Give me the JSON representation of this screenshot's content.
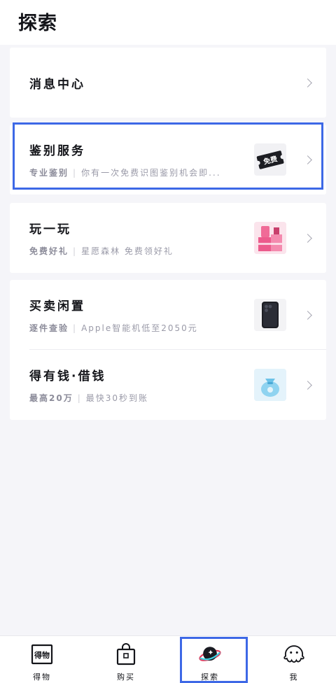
{
  "header": {
    "title": "探索"
  },
  "rows": {
    "messages": {
      "title": "消息中心"
    },
    "appraisal": {
      "title": "鉴别服务",
      "tag": "专业鉴别",
      "desc": "你有一次免费识图鉴别机会即...",
      "badge": "免费"
    },
    "play": {
      "title": "玩一玩",
      "tag": "免费好礼",
      "desc": "星愿森林 免费领好礼"
    },
    "trade": {
      "title": "买卖闲置",
      "tag": "逐件查验",
      "desc": "Apple智能机低至2050元"
    },
    "loan": {
      "title": "得有钱·借钱",
      "tag": "最高20万",
      "desc": "最快30秒到账"
    }
  },
  "tabbar": {
    "items": [
      {
        "label": "得物",
        "icon": "dewu-logo-icon",
        "icon_text": "得物"
      },
      {
        "label": "购买",
        "icon": "shopping-bag-icon"
      },
      {
        "label": "探索",
        "icon": "planet-icon"
      },
      {
        "label": "我",
        "icon": "ghost-avatar-icon"
      }
    ]
  },
  "colors": {
    "highlight": "#3d68e6",
    "background": "#f5f5f9",
    "card": "#ffffff"
  }
}
